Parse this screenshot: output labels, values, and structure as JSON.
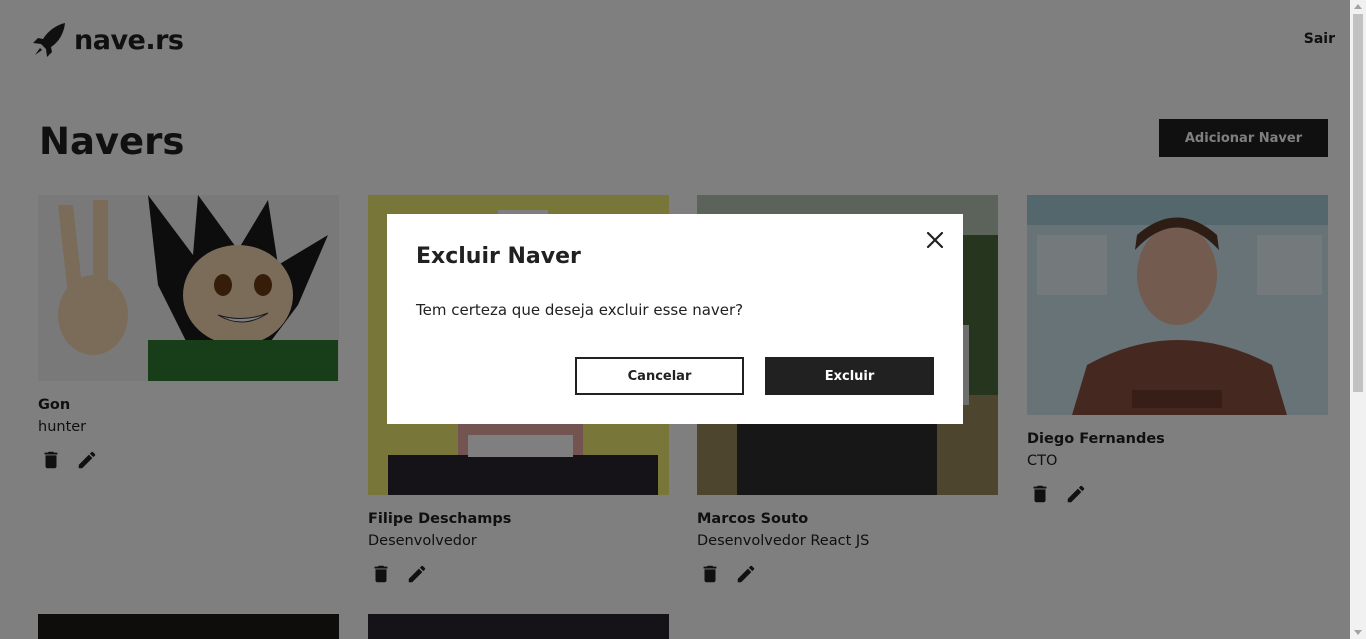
{
  "header": {
    "brand": "nave.rs",
    "logout_label": "Sair"
  },
  "main": {
    "title": "Navers",
    "add_label": "Adicionar Naver",
    "navers": [
      {
        "name": "Gon",
        "role": "hunter"
      },
      {
        "name": "Filipe Deschamps",
        "role": "Desenvolvedor"
      },
      {
        "name": "Marcos Souto",
        "role": "Desenvolvedor React JS"
      },
      {
        "name": "Diego Fernandes",
        "role": "CTO"
      }
    ]
  },
  "modal": {
    "title": "Excluir Naver",
    "message": "Tem certeza que deseja excluir esse naver?",
    "cancel_label": "Cancelar",
    "confirm_label": "Excluir"
  },
  "icons": {
    "brand": "rocket-icon",
    "delete": "trash-icon",
    "edit": "pencil-icon",
    "close": "close-icon"
  },
  "colors": {
    "primary": "#212121",
    "background": "#ffffff",
    "overlay": "rgba(0,0,0,0.5)"
  }
}
